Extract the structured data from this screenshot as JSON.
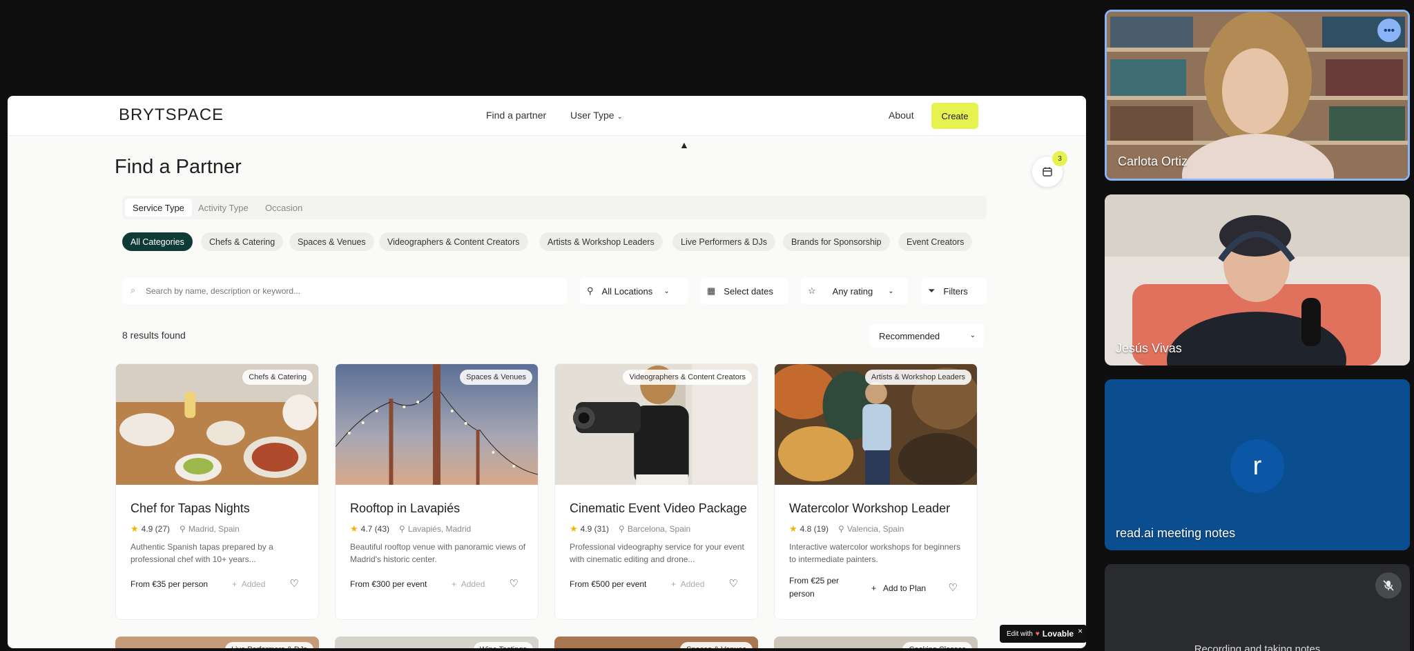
{
  "nav": {
    "logo": "BRYTSPACE",
    "find_partner": "Find a partner",
    "user_type": "User Type",
    "about": "About",
    "create": "Create"
  },
  "page": {
    "title": "Find a Partner",
    "plan_count": "3"
  },
  "tabs": [
    "Service Type",
    "Activity Type",
    "Occasion"
  ],
  "categories": [
    "All Categories",
    "Chefs & Catering",
    "Spaces & Venues",
    "Videographers & Content Creators",
    "Artists & Workshop Leaders",
    "Live Performers & DJs",
    "Brands for Sponsorship",
    "Event Creators"
  ],
  "search": {
    "placeholder": "Search by name, description or keyword...",
    "location": "All Locations",
    "dates": "Select dates",
    "rating": "Any rating",
    "filters": "Filters"
  },
  "results": {
    "count_text": "8 results found",
    "sort": "Recommended"
  },
  "cards": [
    {
      "tag": "Chefs & Catering",
      "title": "Chef for Tapas Nights",
      "rating": "4.9 (27)",
      "location": "Madrid, Spain",
      "desc": "Authentic Spanish tapas prepared by a professional chef with 10+ years...",
      "price": "From €35 per person",
      "action": "Added"
    },
    {
      "tag": "Spaces & Venues",
      "title": "Rooftop in Lavapiés",
      "rating": "4.7 (43)",
      "location": "Lavapiés, Madrid",
      "desc": "Beautiful rooftop venue with panoramic views of Madrid's historic center.",
      "price": "From €300 per event",
      "action": "Added"
    },
    {
      "tag": "Videographers & Content Creators",
      "title": "Cinematic Event Video Package",
      "rating": "4.9 (31)",
      "location": "Barcelona, Spain",
      "desc": "Professional videography service for your event with cinematic editing and drone...",
      "price": "From €500 per event",
      "action": "Added"
    },
    {
      "tag": "Artists & Workshop Leaders",
      "title": "Watercolor Workshop Leader",
      "rating": "4.8 (19)",
      "location": "Valencia, Spain",
      "desc": "Interactive watercolor workshops for beginners to intermediate painters.",
      "price": "From €25 per person",
      "action": "Add to Plan"
    }
  ],
  "row2_tags": [
    "Live Performers & DJs",
    "Wine Tastings",
    "Spaces & Venues",
    "Cooking Classes"
  ],
  "lovable": {
    "prefix": "Edit with",
    "brand": "Lovable"
  },
  "participants": [
    {
      "name": "Carlota Ortiz"
    },
    {
      "name": "Jesús Vivas"
    },
    {
      "name": "read.ai meeting notes",
      "initial": "r"
    },
    {
      "status": "Recording and taking notes"
    }
  ],
  "colors": {
    "accent": "#e6f24d",
    "chip_active": "#0f3b36",
    "meet_bg": "#0f0f10",
    "avatar_tile": "#0b57a6"
  }
}
